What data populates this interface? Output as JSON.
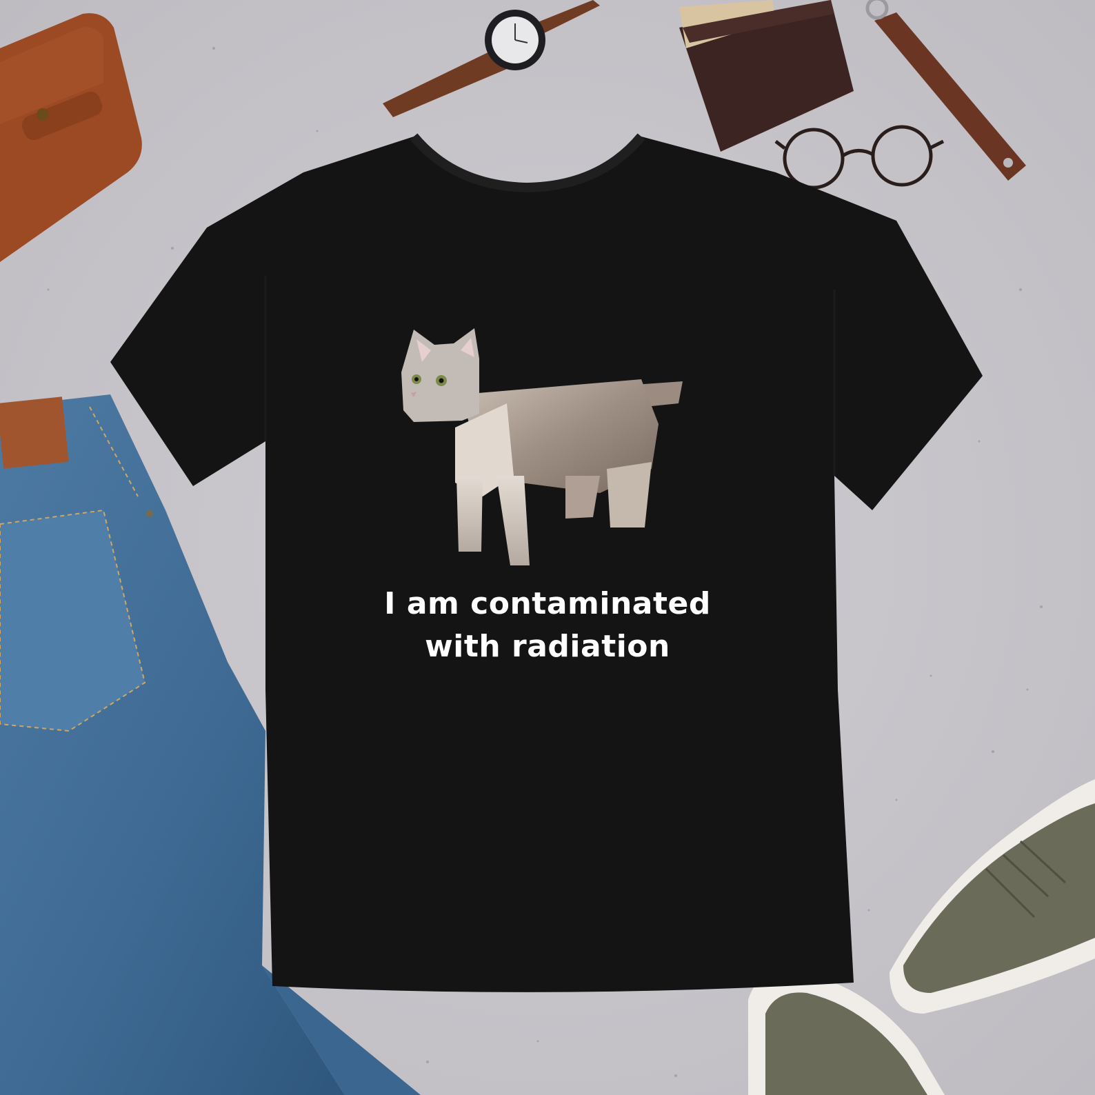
{
  "shirt": {
    "print_text_line_1": "I am contaminated",
    "print_text_line_2": "with radiation",
    "color": "#141414"
  },
  "scene": {
    "background_color": "#c9c7cc",
    "objects": [
      "leather-notebook",
      "wristwatch",
      "wallet",
      "keychain-strap",
      "eyeglasses",
      "jeans",
      "sneaker",
      "sneaker"
    ]
  }
}
